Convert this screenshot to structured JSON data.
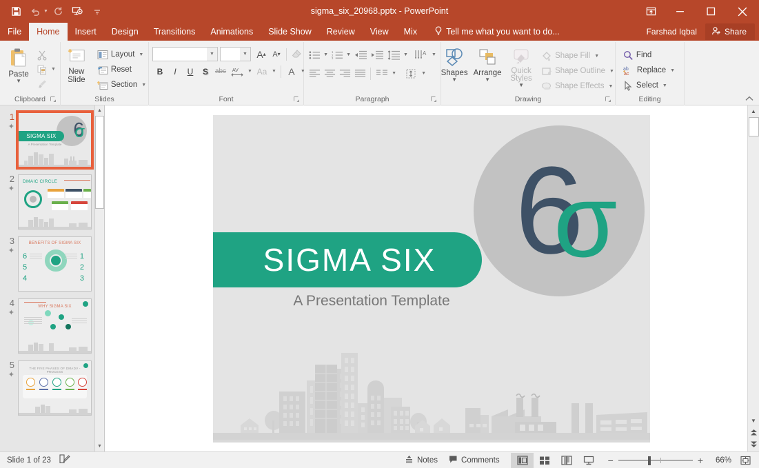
{
  "app": {
    "title": "sigma_six_20968.pptx - PowerPoint",
    "accent_color": "#b7472a",
    "theme_teal": "#1fa383",
    "theme_navy": "#3e5166"
  },
  "quick_access": [
    {
      "name": "save",
      "icon": "save-icon",
      "label": "Save"
    },
    {
      "name": "undo",
      "icon": "undo-icon",
      "label": "Undo"
    },
    {
      "name": "redo",
      "icon": "redo-icon",
      "label": "Redo"
    },
    {
      "name": "start-slideshow",
      "icon": "slideshow-icon",
      "label": "Start From Beginning"
    },
    {
      "name": "customize",
      "icon": "chevron-down-icon",
      "label": "Customize Quick Access Toolbar"
    }
  ],
  "window_controls": {
    "ribbon_display": "Ribbon Display Options",
    "minimize": "Minimize",
    "restore": "Restore Down",
    "close": "Close"
  },
  "tabs": [
    {
      "label": "File",
      "active": false
    },
    {
      "label": "Home",
      "active": true
    },
    {
      "label": "Insert",
      "active": false
    },
    {
      "label": "Design",
      "active": false
    },
    {
      "label": "Transitions",
      "active": false
    },
    {
      "label": "Animations",
      "active": false
    },
    {
      "label": "Slide Show",
      "active": false
    },
    {
      "label": "Review",
      "active": false
    },
    {
      "label": "View",
      "active": false
    },
    {
      "label": "Mix",
      "active": false
    }
  ],
  "tell_me": "Tell me what you want to do...",
  "account": {
    "name": "Farshad Iqbal",
    "share_label": "Share"
  },
  "ribbon": {
    "clipboard": {
      "label": "Clipboard",
      "paste": "Paste",
      "cut": "Cut",
      "copy": "Copy",
      "format_painter": "Format Painter"
    },
    "slides": {
      "label": "Slides",
      "new_slide": "New Slide",
      "layout": "Layout",
      "reset": "Reset",
      "section": "Section"
    },
    "font": {
      "label": "Font",
      "font_name_value": "",
      "font_name_placeholder": "",
      "font_size_value": "",
      "grow_font": "Increase Font Size",
      "shrink_font": "Decrease Font Size",
      "clear_formatting": "Clear All Formatting",
      "bold": "B",
      "italic": "I",
      "underline": "U",
      "shadow": "S",
      "strikethrough": "abc",
      "character_spacing": "AV",
      "change_case": "Aa",
      "font_color": "A"
    },
    "paragraph": {
      "label": "Paragraph",
      "bullets": "Bullets",
      "numbering": "Numbering",
      "decrease_indent": "Decrease List Level",
      "increase_indent": "Increase List Level",
      "line_spacing": "Line Spacing",
      "text_direction": "Text Direction",
      "align_text": "Align Text",
      "convert_smartart": "Convert to SmartArt",
      "align_left": "Align Left",
      "align_center": "Center",
      "align_right": "Align Right",
      "justify": "Justify",
      "columns": "Columns"
    },
    "drawing": {
      "label": "Drawing",
      "shapes": "Shapes",
      "arrange": "Arrange",
      "quick_styles": "Quick Styles",
      "shape_fill": "Shape Fill",
      "shape_outline": "Shape Outline",
      "shape_effects": "Shape Effects"
    },
    "editing": {
      "label": "Editing",
      "find": "Find",
      "replace": "Replace",
      "select": "Select",
      "collapse": "Collapse the Ribbon"
    }
  },
  "thumbnails": [
    {
      "number": "1",
      "title": "SIGMA SIX",
      "subtitle": "A Presentation Template",
      "selected": true
    },
    {
      "number": "2",
      "title": "DMAIC CIRCLE",
      "selected": false
    },
    {
      "number": "3",
      "title": "BENEFITS OF SIGMA SIX",
      "selected": false
    },
    {
      "number": "4",
      "title": "WHY SIGMA SIX",
      "selected": false
    },
    {
      "number": "5",
      "title": "THE FIVE PHASES OF DMADV - PROCESS",
      "selected": false
    }
  ],
  "slide": {
    "title": "SIGMA SIX",
    "subtitle": "A Presentation Template",
    "logo_digit": "6",
    "logo_sigma": "σ"
  },
  "status": {
    "slide_counter": "Slide 1 of 23",
    "notes_label": "Notes",
    "comments_label": "Comments",
    "zoom_percent": "66%",
    "zoom_out": "−",
    "zoom_in": "+",
    "views": [
      {
        "name": "normal",
        "label": "Normal",
        "active": true
      },
      {
        "name": "slide-sorter",
        "label": "Slide Sorter",
        "active": false
      },
      {
        "name": "reading-view",
        "label": "Reading View",
        "active": false
      },
      {
        "name": "slide-show",
        "label": "Slide Show",
        "active": false
      }
    ],
    "fit_label": "Fit slide to current window"
  }
}
